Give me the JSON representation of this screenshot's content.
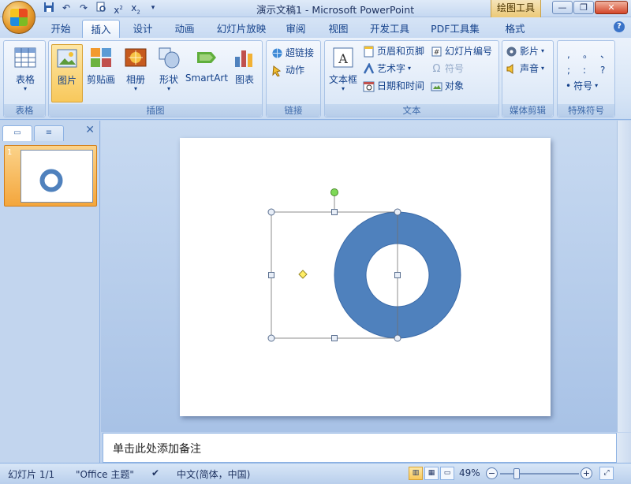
{
  "titlebar": {
    "title": "演示文稿1 - Microsoft PowerPoint",
    "context_tab": "绘图工具",
    "qat": [
      "save-icon",
      "undo-icon",
      "redo-icon",
      "print-preview-icon",
      "custom-icon-1",
      "custom-icon-2",
      "customize-arrow-icon"
    ]
  },
  "tabs": [
    "开始",
    "插入",
    "设计",
    "动画",
    "幻灯片放映",
    "审阅",
    "视图",
    "开发工具",
    "PDF工具集",
    "格式"
  ],
  "active_tab": "插入",
  "ribbon": {
    "groups": {
      "tables": "表格",
      "illustrations": "插图",
      "links": "链接",
      "text": "文本",
      "media": "媒体剪辑",
      "special": "特殊符号"
    },
    "buttons": {
      "table": "表格",
      "picture": "图片",
      "clipart": "剪贴画",
      "album": "相册",
      "shapes": "形状",
      "smartart": "SmartArt",
      "chart": "图表",
      "hyperlink": "超链接",
      "action": "动作",
      "textbox": "文本框",
      "header_footer": "页眉和页脚",
      "wordart": "艺术字",
      "datetime": "日期和时间",
      "slide_number": "幻灯片编号",
      "symbol": "符号",
      "object": "对象",
      "movie": "影片",
      "sound": "声音",
      "special_symbol": "符号"
    },
    "special_symbols": [
      ",",
      "。",
      "、",
      ";",
      ":",
      "?"
    ]
  },
  "leftpane": {
    "slide_number": "1"
  },
  "notes": {
    "placeholder": "单击此处添加备注"
  },
  "statusbar": {
    "slide": "幻灯片 1/1",
    "theme": "\"Office 主题\"",
    "language": "中文(简体，中国)",
    "zoom": "49%"
  },
  "colors": {
    "shape_fill": "#4f81bd",
    "shape_stroke": "#3a6aa8",
    "handle_green": "#7ed957",
    "handle_yellow": "#ffee66"
  }
}
